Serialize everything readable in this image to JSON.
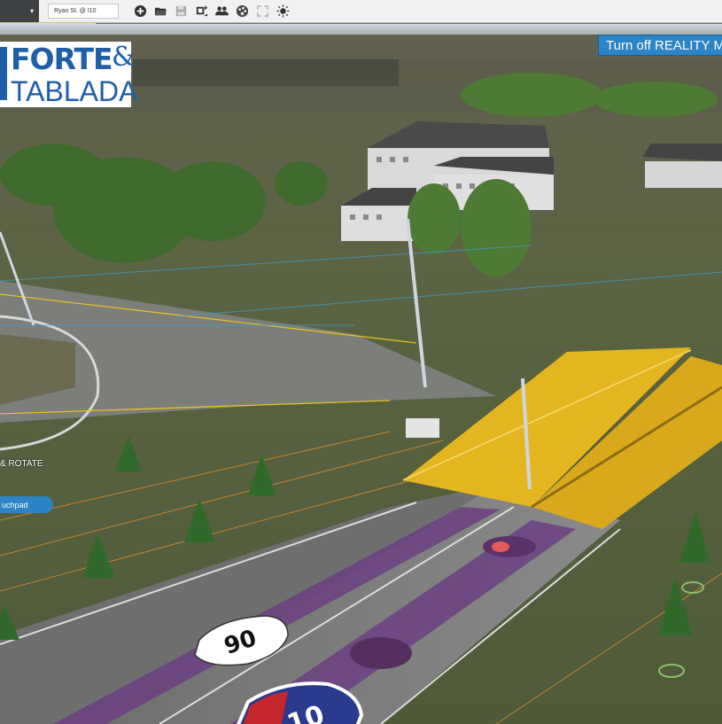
{
  "toolbar": {
    "dropdown_caret": "▾",
    "location_label": "Ryan St. @ I10",
    "icons": [
      "add-icon",
      "folder-open-icon",
      "save-icon",
      "layers-icon",
      "users-icon",
      "palette-icon",
      "fullscreen-icon",
      "brightness-icon"
    ]
  },
  "logo": {
    "line1": "FORTE",
    "ampersand": "&",
    "line2": "TABLADA"
  },
  "reality_button": {
    "label": "Turn off REALITY M"
  },
  "hint": {
    "label": "& ROTATE"
  },
  "touch_button": {
    "label": "uchpad"
  },
  "road_signs": {
    "us_route": "90",
    "interstate": "10"
  },
  "colors": {
    "toolbar_bg": "#f1f1f1",
    "accent_blue": "#2a84c6",
    "logo_blue": "#1f5fa8",
    "road_purple": "#6b3f82",
    "bridge_yellow": "#e3b51e",
    "grass_green": "#5a6e3a",
    "tree_green": "#2f6a2a"
  }
}
